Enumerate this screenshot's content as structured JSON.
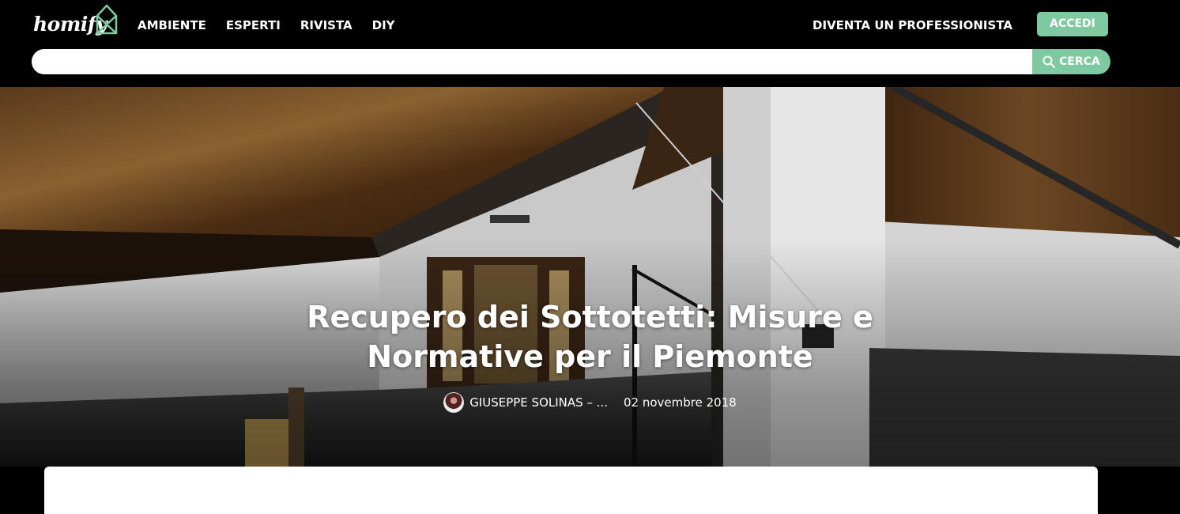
{
  "header": {
    "logo_text": "homify",
    "nav": [
      "AMBIENTE",
      "ESPERTI",
      "RIVISTA",
      "DIY"
    ],
    "become_pro_label": "DIVENTA UN PROFESSIONISTA",
    "login_label": "ACCEDI"
  },
  "search": {
    "placeholder": "",
    "value": "",
    "button_label": "CERCA",
    "icon": "search-icon"
  },
  "article": {
    "title_line1": "Recupero dei Sottotetti: Misure e",
    "title_line2": "Normative per il Piemonte",
    "author": "GIUSEPPE SOLINAS – ...",
    "date": "02 novembre 2018"
  },
  "colors": {
    "header_bg": "#000000",
    "accent": "#7fc9a0",
    "text_light": "#ffffff"
  }
}
